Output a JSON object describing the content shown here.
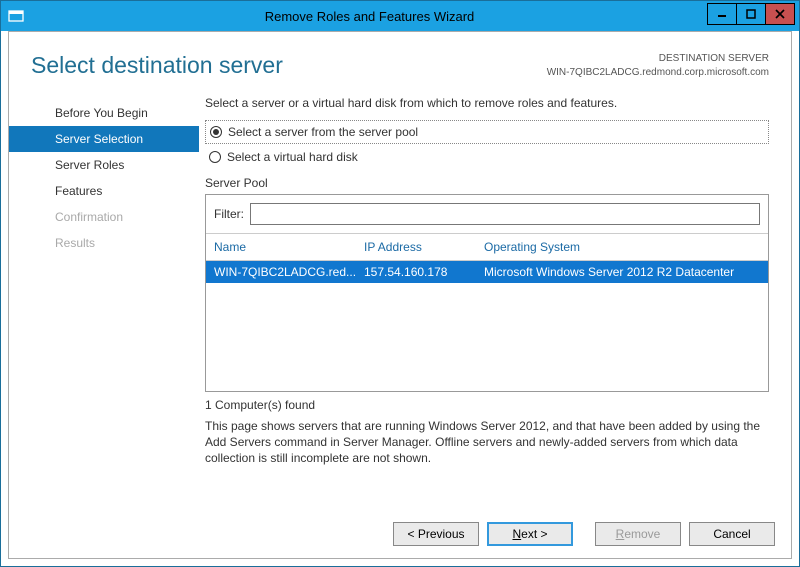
{
  "window": {
    "title": "Remove Roles and Features Wizard"
  },
  "header": {
    "title": "Select destination server",
    "dest_label": "DESTINATION SERVER",
    "dest_value": "WIN-7QIBC2LADCG.redmond.corp.microsoft.com"
  },
  "nav": {
    "items": [
      {
        "label": "Before You Begin",
        "state": "normal"
      },
      {
        "label": "Server Selection",
        "state": "active"
      },
      {
        "label": "Server Roles",
        "state": "normal"
      },
      {
        "label": "Features",
        "state": "normal"
      },
      {
        "label": "Confirmation",
        "state": "disabled"
      },
      {
        "label": "Results",
        "state": "disabled"
      }
    ]
  },
  "main": {
    "instruction": "Select a server or a virtual hard disk from which to remove roles and features.",
    "radio_pool": "Select a server from the server pool",
    "radio_vhd": "Select a virtual hard disk",
    "section_label": "Server Pool",
    "filter_label": "Filter:",
    "filter_value": "",
    "columns": {
      "name": "Name",
      "ip": "IP Address",
      "os": "Operating System"
    },
    "rows": [
      {
        "name": "WIN-7QIBC2LADCG.red...",
        "ip": "157.54.160.178",
        "os": "Microsoft Windows Server 2012 R2 Datacenter"
      }
    ],
    "found": "1 Computer(s) found",
    "description": "This page shows servers that are running Windows Server 2012, and that have been added by using the Add Servers command in Server Manager. Offline servers and newly-added servers from which data collection is still incomplete are not shown."
  },
  "footer": {
    "previous": "< Previous",
    "next_prefix": "N",
    "next_suffix": "ext >",
    "remove_prefix": "R",
    "remove_suffix": "emove",
    "cancel": "Cancel"
  }
}
